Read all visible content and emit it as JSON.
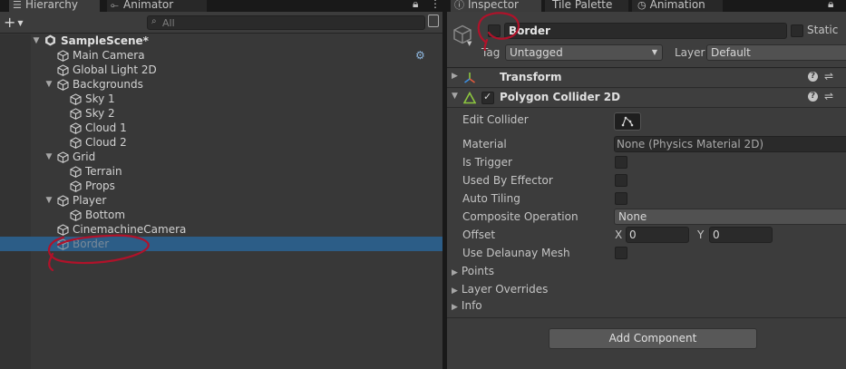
{
  "hierarchy": {
    "tab_label": "Hierarchy",
    "tab2_label": "Animator",
    "search_placeholder": "All",
    "add_label": "+",
    "rows": [
      {
        "label": "SampleScene*"
      },
      {
        "label": "Main Camera"
      },
      {
        "label": "Global Light 2D"
      },
      {
        "label": "Backgrounds"
      },
      {
        "label": "Sky 1"
      },
      {
        "label": "Sky 2"
      },
      {
        "label": "Cloud 1"
      },
      {
        "label": "Cloud 2"
      },
      {
        "label": "Grid"
      },
      {
        "label": "Terrain"
      },
      {
        "label": "Props"
      },
      {
        "label": "Player"
      },
      {
        "label": "Bottom"
      },
      {
        "label": "CinemachineCamera"
      },
      {
        "label": "Border"
      }
    ]
  },
  "inspector": {
    "tab_label": "Inspector",
    "tab2_label": "Tile Palette",
    "tab3_label": "Animation",
    "object_name": "Border",
    "static_label": "Static",
    "tag_label": "Tag",
    "tag_value": "Untagged",
    "layer_label": "Layer",
    "layer_value": "Default",
    "transform_label": "Transform",
    "collider_label": "Polygon Collider 2D",
    "props": {
      "edit_collider": "Edit Collider",
      "material": "Material",
      "material_value": "None (Physics Material 2D)",
      "is_trigger": "Is Trigger",
      "used_by_effector": "Used By Effector",
      "auto_tiling": "Auto Tiling",
      "composite_operation": "Composite Operation",
      "composite_value": "None",
      "offset": "Offset",
      "offset_x_label": "X",
      "offset_x": "0",
      "offset_y_label": "Y",
      "offset_y": "0",
      "use_delaunay": "Use Delaunay Mesh",
      "points": "Points",
      "layer_overrides": "Layer Overrides",
      "info": "Info"
    },
    "add_component": "Add Component"
  },
  "colors": {
    "selection": "#2c5d87",
    "annotation": "#b0122a"
  }
}
